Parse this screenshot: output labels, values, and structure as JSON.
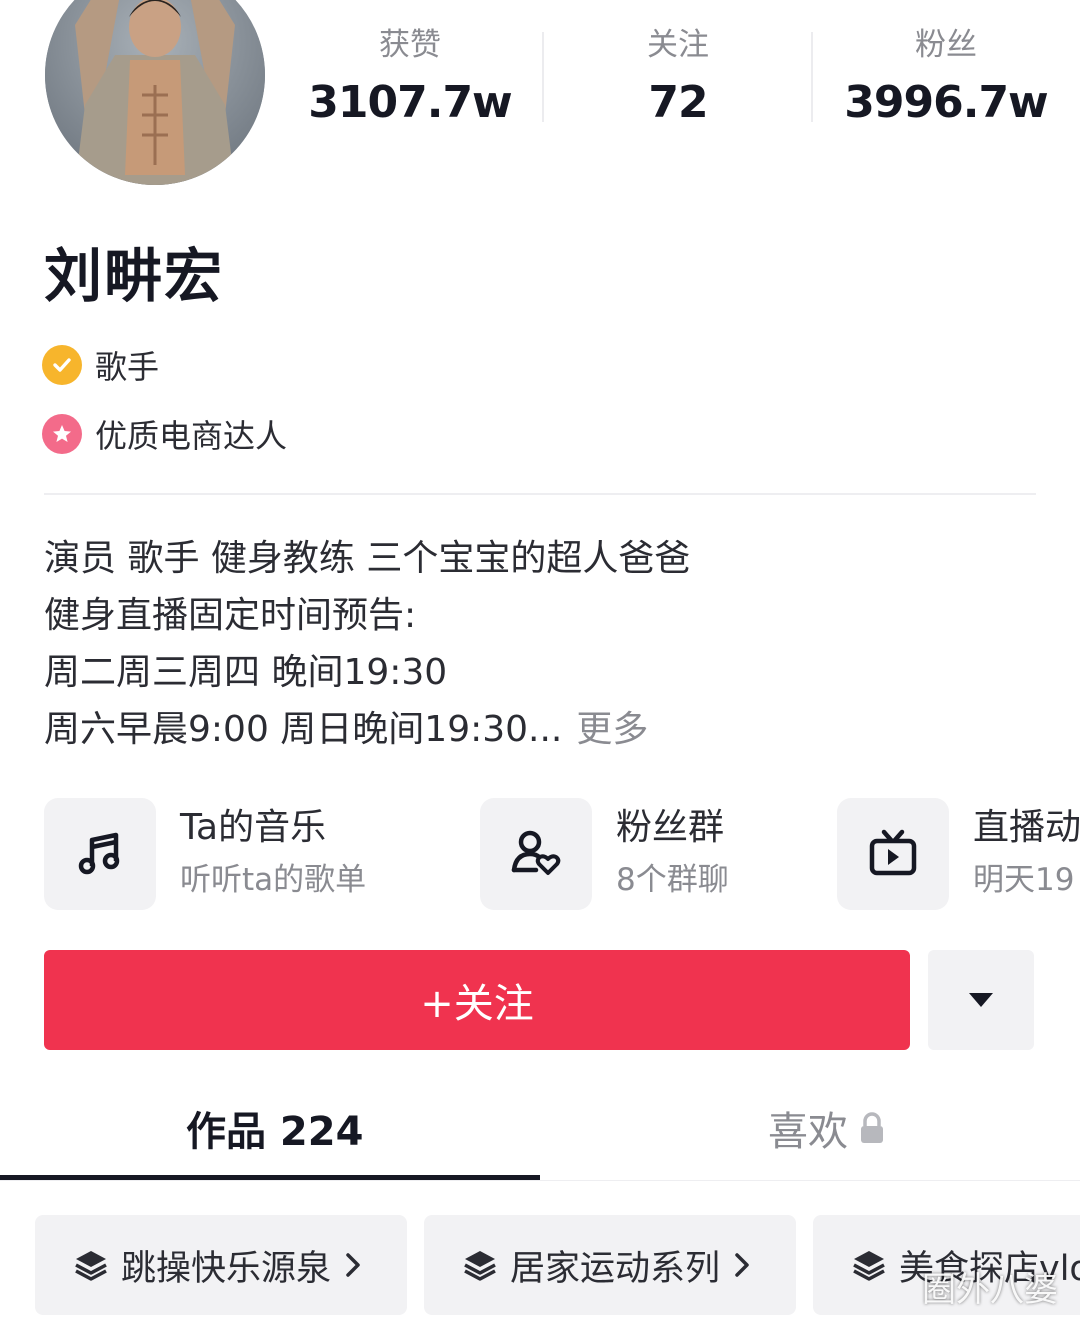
{
  "profile": {
    "name": "刘畊宏",
    "tags": [
      {
        "icon": "verified-check-icon",
        "label": "歌手",
        "color": "#f7b52c"
      },
      {
        "icon": "star-badge-icon",
        "label": "优质电商达人",
        "color": "#f36b8a"
      }
    ]
  },
  "stats": [
    {
      "label": "获赞",
      "value": "3107.7w"
    },
    {
      "label": "关注",
      "value": "72"
    },
    {
      "label": "粉丝",
      "value": "3996.7w"
    }
  ],
  "bio": {
    "lines": [
      "演员 歌手 健身教练 三个宝宝的超人爸爸",
      "健身直播固定时间预告:",
      "周二周三周四 晚间19:30",
      "周六早晨9:00 周日晚间19:30..."
    ],
    "more_label": "更多"
  },
  "entries": [
    {
      "icon": "music-note-icon",
      "title": "Ta的音乐",
      "subtitle": "听听ta的歌单"
    },
    {
      "icon": "fan-group-icon",
      "title": "粉丝群",
      "subtitle": "8个群聊"
    },
    {
      "icon": "live-tv-icon",
      "title": "直播动",
      "subtitle": "明天19"
    }
  ],
  "actions": {
    "follow_label": "+关注",
    "follow_color": "#f0334f",
    "more_icon": "caret-down-icon"
  },
  "tabs": [
    {
      "label": "作品 224",
      "active": true
    },
    {
      "label": "喜欢",
      "active": false,
      "icon": "lock-icon"
    }
  ],
  "collections": [
    {
      "icon": "layers-icon",
      "label": "跳操快乐源泉"
    },
    {
      "icon": "layers-icon",
      "label": "居家运动系列"
    },
    {
      "icon": "layers-icon",
      "label": "美食探店vlo"
    }
  ],
  "watermark": "圈外八婆"
}
